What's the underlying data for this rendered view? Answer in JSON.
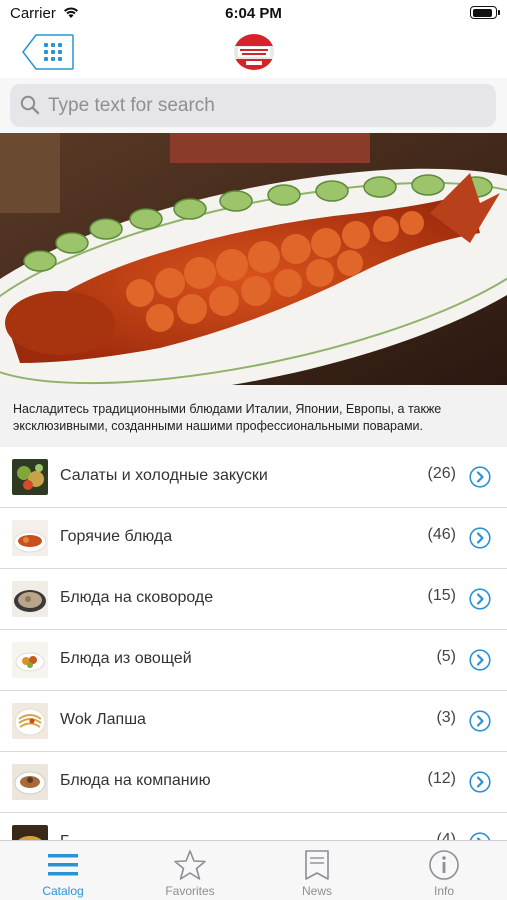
{
  "status_bar": {
    "carrier": "Carrier",
    "time": "6:04 PM",
    "battery_level": 0.95
  },
  "nav": {
    "grid_icon": "grid-icon",
    "logo_icon": "restaurant-logo"
  },
  "search": {
    "placeholder": "Type text for search"
  },
  "hero": {
    "icon": "fish-dish-photo"
  },
  "description": "Насладитесь традиционными блюдами Италии, Японии, Европы, а также эксклюзивными, созданными нашими профессиональными поварами.",
  "categories": [
    {
      "label": "Салаты и холодные закуски",
      "count": "(26)"
    },
    {
      "label": "Горячие блюда",
      "count": "(46)"
    },
    {
      "label": "Блюда на сковороде",
      "count": "(15)"
    },
    {
      "label": "Блюда из овощей",
      "count": "(5)"
    },
    {
      "label": "Wok Лапша",
      "count": "(3)"
    },
    {
      "label": "Блюда на компанию",
      "count": "(12)"
    },
    {
      "label": "Г",
      "count": "(4)"
    }
  ],
  "tabs": [
    {
      "label": "Catalog",
      "icon": "list-icon",
      "active": true
    },
    {
      "label": "Favorites",
      "icon": "star-icon",
      "active": false
    },
    {
      "label": "News",
      "icon": "bookmark-icon",
      "active": false
    },
    {
      "label": "Info",
      "icon": "info-icon",
      "active": false
    }
  ],
  "colors": {
    "accent": "#2a93d5",
    "inactive": "#8e8e93",
    "logo_red": "#d6232a"
  }
}
